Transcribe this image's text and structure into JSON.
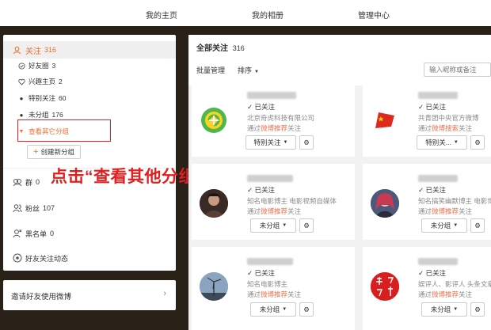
{
  "topnav": {
    "my_home": "我的主页",
    "my_album": "我的相册",
    "admin_center": "管理中心"
  },
  "left": {
    "follow": {
      "label": "关注",
      "count": "316"
    },
    "groups": [
      {
        "label": "好友圈",
        "count": "3"
      },
      {
        "label": "兴趣主页",
        "count": "2"
      },
      {
        "label": "特别关注",
        "count": "60"
      },
      {
        "label": "未分组",
        "count": "176"
      }
    ],
    "view_other_groups": "查看其它分组",
    "create_group": "创建新分组",
    "group_chat": {
      "label": "群",
      "count": "0"
    },
    "fans": {
      "label": "粉丝",
      "count": "107"
    },
    "blacklist": {
      "label": "黑名单",
      "count": "0"
    },
    "friends_activity": "好友关注动态",
    "invite": "邀请好友使用微博"
  },
  "annotation": "点击“查看其他分组”",
  "right": {
    "title": "全部关注",
    "title_count": "316",
    "batch_manage": "批量管理",
    "sort": "排序",
    "search_placeholder": "输入昵称或备注",
    "cards": [
      {
        "status": "已关注",
        "desc": "北京奇虎科技有限公司",
        "via_prefix": "通过",
        "via_link": "微博推荐",
        "via_suffix": "关注",
        "group_btn": "特别关注"
      },
      {
        "status": "已关注",
        "desc": "共青团中央官方微博",
        "via_prefix": "通过",
        "via_link": "微博搜索",
        "via_suffix": "关注",
        "group_btn": "特别关..."
      },
      {
        "status": "已关注",
        "desc": "知名电影博主 电影视频自媒体",
        "via_prefix": "通过",
        "via_link": "微博推荐",
        "via_suffix": "关注",
        "group_btn": "未分组"
      },
      {
        "status": "已关注",
        "desc": "知名搞笑幽默博主 电影博主",
        "via_prefix": "通过",
        "via_link": "微博推荐",
        "via_suffix": "关注",
        "group_btn": "未分组"
      },
      {
        "status": "已关注",
        "desc": "知名电影博主",
        "via_prefix": "通过",
        "via_link": "微博推荐",
        "via_suffix": "关注",
        "group_btn": "未分组"
      },
      {
        "status": "已关注",
        "desc": "娱评人、影评人 头条文章作者",
        "via_prefix": "通过",
        "via_link": "微博推荐",
        "via_suffix": "关注",
        "group_btn": "未分组"
      }
    ]
  },
  "colors": {
    "accent": "#f26c2c",
    "annotation": "#e02020",
    "link": "#eb7350",
    "background": "#2a2119"
  }
}
